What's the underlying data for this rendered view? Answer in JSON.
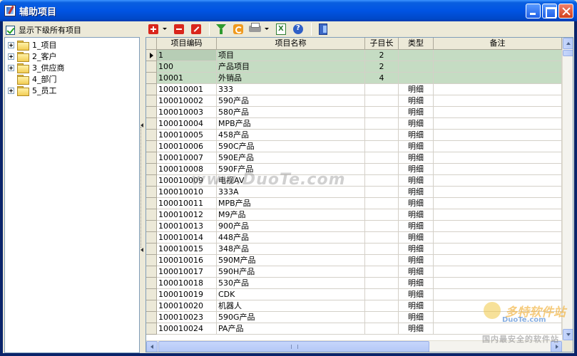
{
  "window": {
    "title": "辅助项目"
  },
  "left_panel": {
    "show_all_label": "显示下级所有项目",
    "tree": [
      {
        "label": "1_项目",
        "expandable": true
      },
      {
        "label": "2_客户",
        "expandable": true
      },
      {
        "label": "3_供应商",
        "expandable": true
      },
      {
        "label": "4_部门",
        "expandable": false
      },
      {
        "label": "5_员工",
        "expandable": true
      }
    ]
  },
  "toolbar": {
    "icons": [
      "add-icon",
      "delete-icon",
      "edit-icon",
      "filter-icon",
      "refresh-icon",
      "print-icon",
      "excel-export-icon",
      "help-icon",
      "exit-icon"
    ]
  },
  "grid": {
    "columns": [
      "项目编码",
      "项目名称",
      "子目长",
      "类型",
      "备注"
    ],
    "rows": [
      {
        "code": "1",
        "name": "项目",
        "sub": "2",
        "type": "",
        "note": "",
        "group": true,
        "current": true
      },
      {
        "code": "100",
        "name": "产品项目",
        "sub": "2",
        "type": "",
        "note": "",
        "group": true
      },
      {
        "code": "10001",
        "name": "外销品",
        "sub": "4",
        "type": "",
        "note": "",
        "group": true
      },
      {
        "code": "100010001",
        "name": "333",
        "sub": "",
        "type": "明细",
        "note": ""
      },
      {
        "code": "100010002",
        "name": "590产品",
        "sub": "",
        "type": "明细",
        "note": ""
      },
      {
        "code": "100010003",
        "name": "580产品",
        "sub": "",
        "type": "明细",
        "note": ""
      },
      {
        "code": "100010004",
        "name": "MPB产品",
        "sub": "",
        "type": "明细",
        "note": ""
      },
      {
        "code": "100010005",
        "name": "458产品",
        "sub": "",
        "type": "明细",
        "note": ""
      },
      {
        "code": "100010006",
        "name": "590C产品",
        "sub": "",
        "type": "明细",
        "note": ""
      },
      {
        "code": "100010007",
        "name": "590E产品",
        "sub": "",
        "type": "明细",
        "note": ""
      },
      {
        "code": "100010008",
        "name": "590F产品",
        "sub": "",
        "type": "明细",
        "note": ""
      },
      {
        "code": "100010009",
        "name": "电视AV",
        "sub": "",
        "type": "明细",
        "note": ""
      },
      {
        "code": "100010010",
        "name": "333A",
        "sub": "",
        "type": "明细",
        "note": ""
      },
      {
        "code": "100010011",
        "name": "MPB产品",
        "sub": "",
        "type": "明细",
        "note": ""
      },
      {
        "code": "100010012",
        "name": "M9产品",
        "sub": "",
        "type": "明细",
        "note": ""
      },
      {
        "code": "100010013",
        "name": "900产品",
        "sub": "",
        "type": "明细",
        "note": ""
      },
      {
        "code": "100010014",
        "name": "448产品",
        "sub": "",
        "type": "明细",
        "note": ""
      },
      {
        "code": "100010015",
        "name": "348产品",
        "sub": "",
        "type": "明细",
        "note": ""
      },
      {
        "code": "100010016",
        "name": "590M产品",
        "sub": "",
        "type": "明细",
        "note": ""
      },
      {
        "code": "100010017",
        "name": "590H产品",
        "sub": "",
        "type": "明细",
        "note": ""
      },
      {
        "code": "100010018",
        "name": "530产品",
        "sub": "",
        "type": "明细",
        "note": ""
      },
      {
        "code": "100010019",
        "name": "CDK",
        "sub": "",
        "type": "明细",
        "note": ""
      },
      {
        "code": "100010020",
        "name": "机器人",
        "sub": "",
        "type": "明细",
        "note": ""
      },
      {
        "code": "100010023",
        "name": "590G产品",
        "sub": "",
        "type": "明细",
        "note": ""
      },
      {
        "code": "100010024",
        "name": "PA产品",
        "sub": "",
        "type": "明细",
        "note": ""
      }
    ]
  },
  "watermark": {
    "text": "www.DuoTe.com",
    "brand": "多特软件站",
    "site": "DuoTe.com",
    "slogan": "国内最安全的软件站"
  },
  "colors": {
    "titlebar": "#0054e3",
    "group_row": "#c5dcc3",
    "face": "#ece9d8"
  }
}
